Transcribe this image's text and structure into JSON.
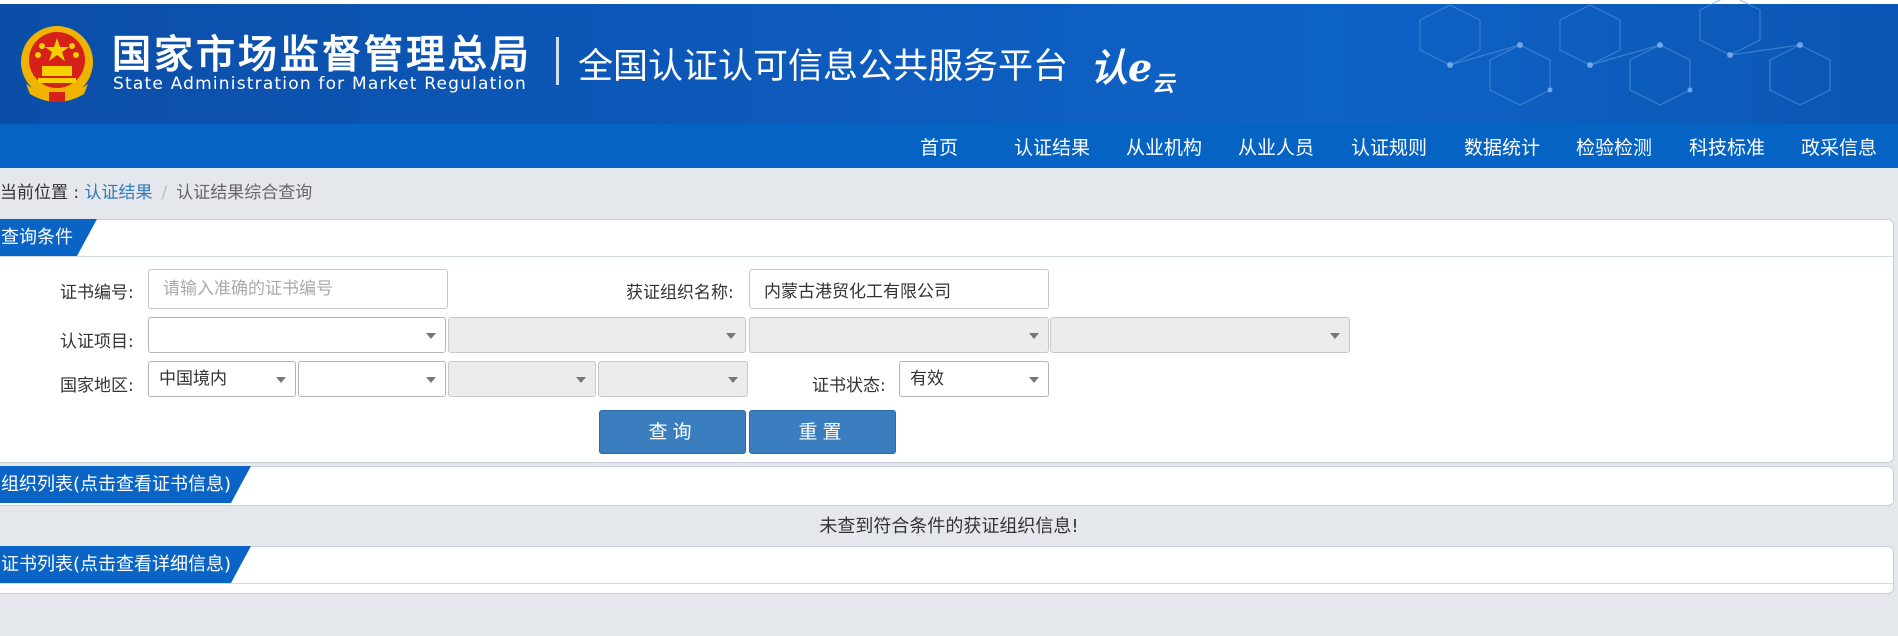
{
  "header": {
    "org_name_cn": "国家市场监督管理总局",
    "org_name_en": "State Administration  for  Market Regulation",
    "platform_title": "全国认证认可信息公共服务平台",
    "platform_logo_main": "认e",
    "platform_logo_small": "云",
    "emblem_icon": "national-emblem-icon",
    "colors": {
      "banner": "#0d5bbd",
      "nav": "#0563c4",
      "accent": "#0a64c5"
    }
  },
  "nav": {
    "items": [
      {
        "label": "首页"
      },
      {
        "label": "认证结果"
      },
      {
        "label": "从业机构"
      },
      {
        "label": "从业人员"
      },
      {
        "label": "认证规则"
      },
      {
        "label": "数据统计"
      },
      {
        "label": "检验检测"
      },
      {
        "label": "科技标准"
      },
      {
        "label": "政采信息"
      }
    ]
  },
  "breadcrumb": {
    "prefix": "当前位置 : ",
    "link": "认证结果",
    "separator": "/",
    "current": "认证结果综合查询"
  },
  "query_panel": {
    "title": "查询条件",
    "cert_no_label": "证书编号:",
    "cert_no_value": "",
    "cert_no_placeholder": "请输入准确的证书编号",
    "org_name_label": "获证组织名称:",
    "org_name_value": "内蒙古港贸化工有限公司",
    "project_label": "认证项目:",
    "project_selects": [
      "",
      "",
      "",
      ""
    ],
    "region_label": "国家地区:",
    "region_selects": [
      "中国境内",
      "",
      "",
      ""
    ],
    "status_label": "证书状态:",
    "status_value": "有效",
    "search_button": "查询",
    "reset_button": "重置"
  },
  "org_list": {
    "title": "组织列表(点击查看证书信息)",
    "empty_message": "未查到符合条件的获证组织信息!"
  },
  "cert_list": {
    "title": "证书列表(点击查看详细信息)"
  }
}
